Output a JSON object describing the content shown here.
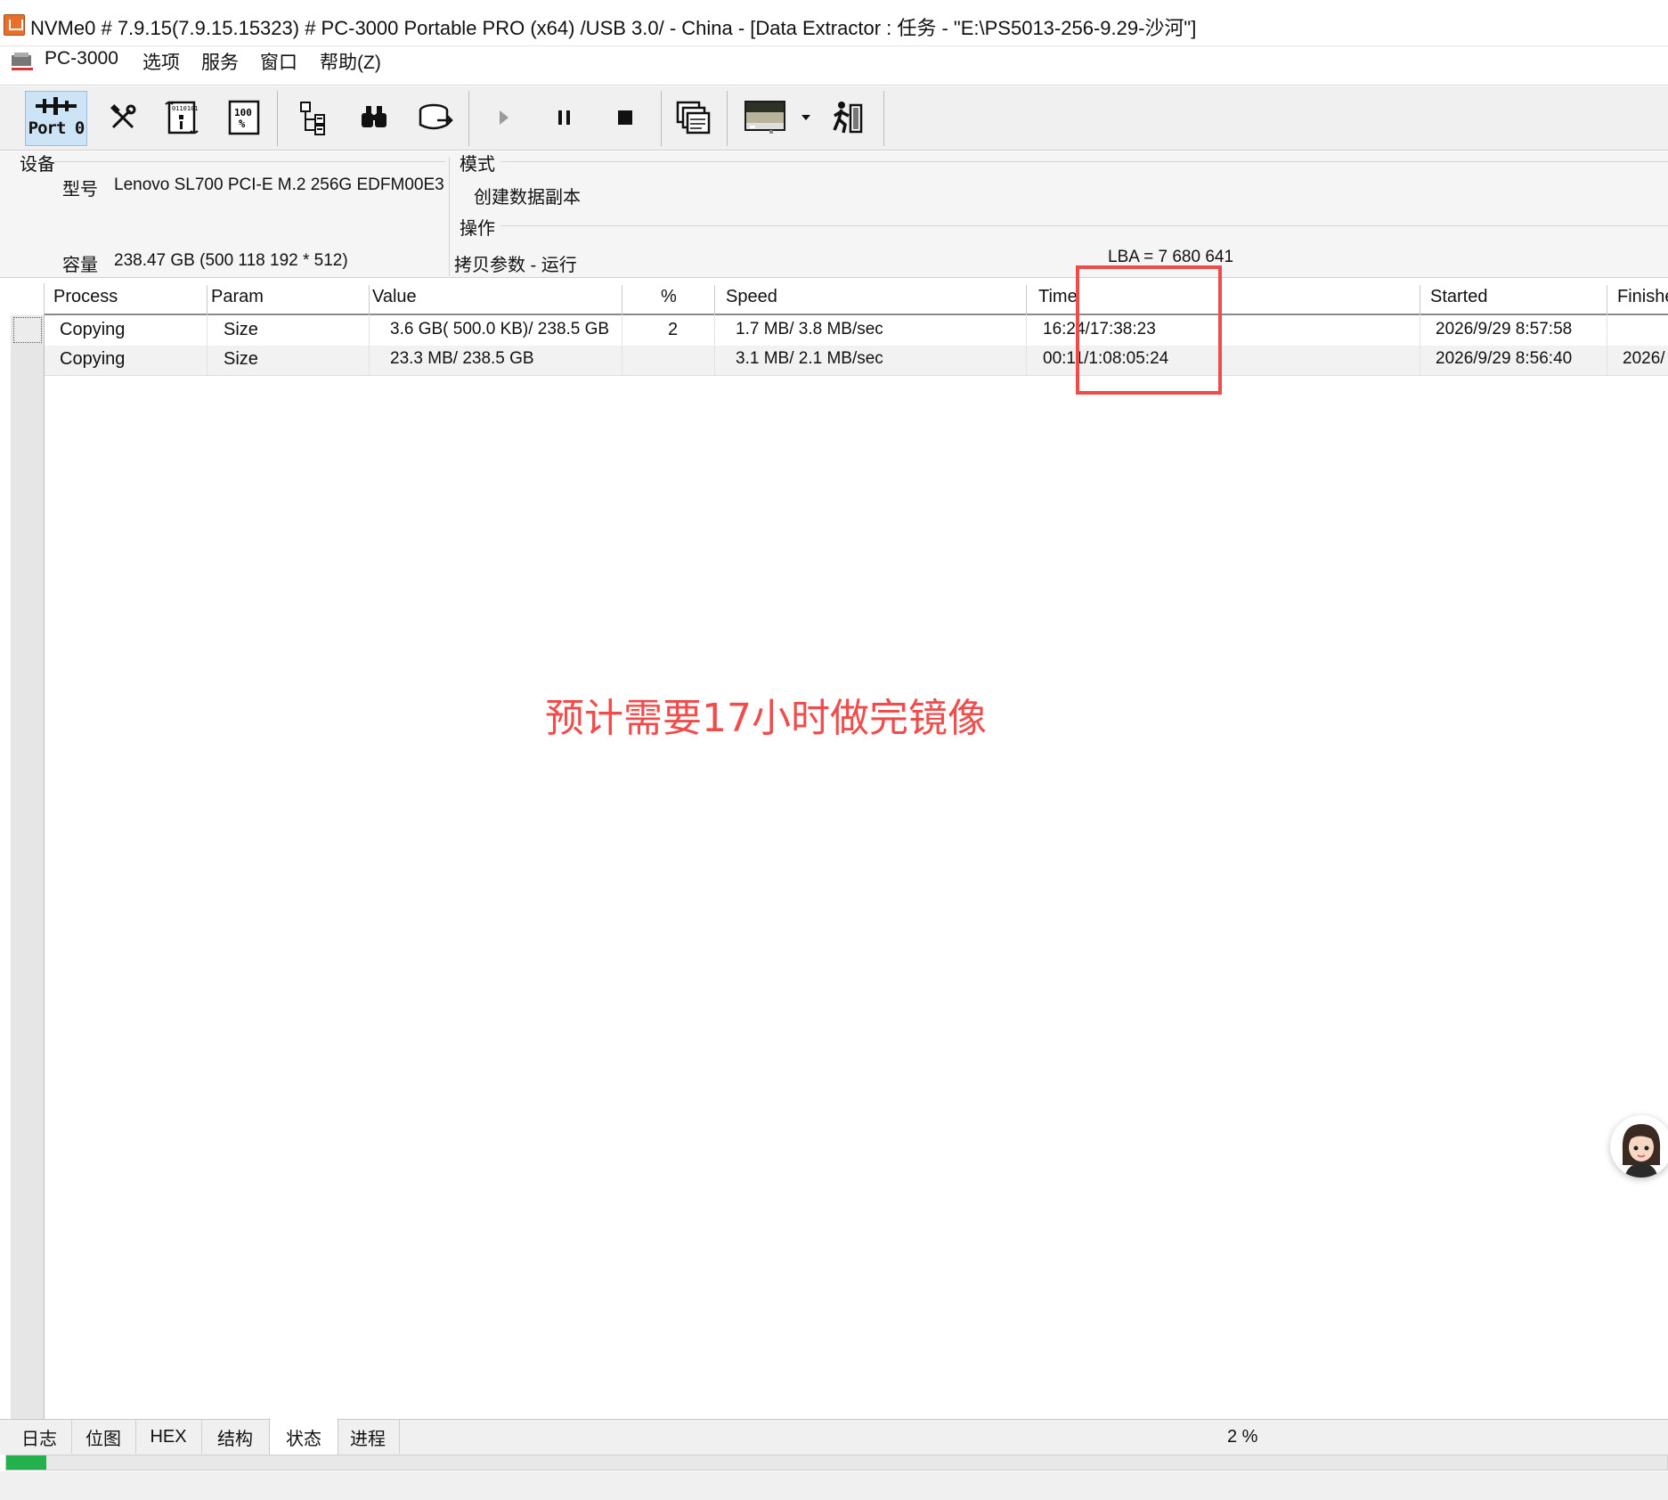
{
  "window": {
    "title": "NVMe0 # 7.9.15(7.9.15.15323) # PC-3000 Portable PRO (x64) /USB 3.0/ - China - [Data Extractor : 任务 - \"E:\\PS5013-256-9.29-沙河\"]"
  },
  "menu": {
    "items": [
      "PC-3000",
      "选项",
      "服务",
      "窗口",
      "帮助(Z)"
    ]
  },
  "toolbar": {
    "port_label": "Port 0",
    "icons": [
      "port-icon",
      "tools-icon",
      "scroll-binary-icon",
      "percent-doc-icon",
      "tree-icon",
      "binoculars-icon",
      "disk-export-icon",
      "play-icon",
      "pause-icon",
      "stop-icon",
      "windows-icon",
      "screen-icon",
      "dropdown-arrow-icon",
      "runner-icon"
    ]
  },
  "device": {
    "group_label": "设备",
    "model_label": "型号",
    "model_value": "Lenovo  SL700 PCI-E M.2 256G EDFM00E3",
    "capacity_label": "容量",
    "capacity_value": "238.47 GB (500 118 192 * 512)"
  },
  "mode": {
    "group_label": "模式",
    "value": "创建数据副本"
  },
  "operation": {
    "group_label": "操作",
    "status": "拷贝参数 - 运行",
    "lba": "LBA =    7 680 641"
  },
  "table": {
    "headers": [
      "Process",
      "Param",
      "Value",
      "%",
      "Speed",
      "Time",
      "Started",
      "Finishe"
    ],
    "rows": [
      {
        "process": "Copying",
        "param": "Size",
        "value": "3.6 GB( 500.0 KB)/ 238.5 GB",
        "percent": "2",
        "speed": "1.7 MB/ 3.8 MB/sec",
        "time": "16:24/17:38:23",
        "started": "2026/9/29 8:57:58",
        "finished": ""
      },
      {
        "process": "Copying",
        "param": "Size",
        "value": "23.3 MB/ 238.5 GB",
        "percent": "",
        "speed": "3.1 MB/ 2.1 MB/sec",
        "time": "00:11/1:08:05:24",
        "started": "2026/9/29 8:56:40",
        "finished": "2026/"
      }
    ]
  },
  "annotation": {
    "text": "预计需要17小时做完镜像",
    "color": "#f04c4c"
  },
  "tabs": {
    "items": [
      "日志",
      "位图",
      "HEX",
      "结构",
      "状态",
      "进程"
    ],
    "active_index": 4
  },
  "progress": {
    "text": "2 %",
    "fraction": 0.024,
    "color": "#22b14c"
  }
}
